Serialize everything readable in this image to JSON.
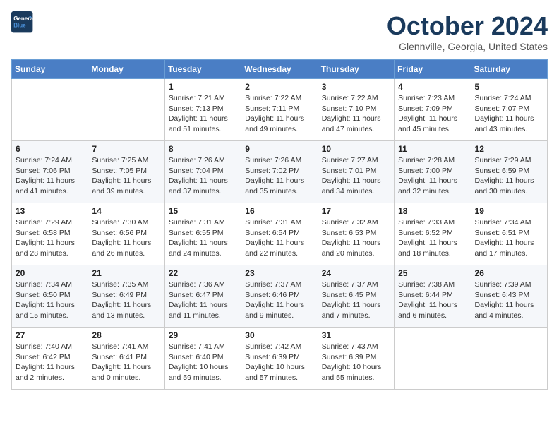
{
  "header": {
    "logo_line1": "General",
    "logo_line2": "Blue",
    "month_title": "October 2024",
    "location": "Glennville, Georgia, United States"
  },
  "weekdays": [
    "Sunday",
    "Monday",
    "Tuesday",
    "Wednesday",
    "Thursday",
    "Friday",
    "Saturday"
  ],
  "weeks": [
    [
      {
        "day": "",
        "info": ""
      },
      {
        "day": "",
        "info": ""
      },
      {
        "day": "1",
        "info": "Sunrise: 7:21 AM\nSunset: 7:13 PM\nDaylight: 11 hours and 51 minutes."
      },
      {
        "day": "2",
        "info": "Sunrise: 7:22 AM\nSunset: 7:11 PM\nDaylight: 11 hours and 49 minutes."
      },
      {
        "day": "3",
        "info": "Sunrise: 7:22 AM\nSunset: 7:10 PM\nDaylight: 11 hours and 47 minutes."
      },
      {
        "day": "4",
        "info": "Sunrise: 7:23 AM\nSunset: 7:09 PM\nDaylight: 11 hours and 45 minutes."
      },
      {
        "day": "5",
        "info": "Sunrise: 7:24 AM\nSunset: 7:07 PM\nDaylight: 11 hours and 43 minutes."
      }
    ],
    [
      {
        "day": "6",
        "info": "Sunrise: 7:24 AM\nSunset: 7:06 PM\nDaylight: 11 hours and 41 minutes."
      },
      {
        "day": "7",
        "info": "Sunrise: 7:25 AM\nSunset: 7:05 PM\nDaylight: 11 hours and 39 minutes."
      },
      {
        "day": "8",
        "info": "Sunrise: 7:26 AM\nSunset: 7:04 PM\nDaylight: 11 hours and 37 minutes."
      },
      {
        "day": "9",
        "info": "Sunrise: 7:26 AM\nSunset: 7:02 PM\nDaylight: 11 hours and 35 minutes."
      },
      {
        "day": "10",
        "info": "Sunrise: 7:27 AM\nSunset: 7:01 PM\nDaylight: 11 hours and 34 minutes."
      },
      {
        "day": "11",
        "info": "Sunrise: 7:28 AM\nSunset: 7:00 PM\nDaylight: 11 hours and 32 minutes."
      },
      {
        "day": "12",
        "info": "Sunrise: 7:29 AM\nSunset: 6:59 PM\nDaylight: 11 hours and 30 minutes."
      }
    ],
    [
      {
        "day": "13",
        "info": "Sunrise: 7:29 AM\nSunset: 6:58 PM\nDaylight: 11 hours and 28 minutes."
      },
      {
        "day": "14",
        "info": "Sunrise: 7:30 AM\nSunset: 6:56 PM\nDaylight: 11 hours and 26 minutes."
      },
      {
        "day": "15",
        "info": "Sunrise: 7:31 AM\nSunset: 6:55 PM\nDaylight: 11 hours and 24 minutes."
      },
      {
        "day": "16",
        "info": "Sunrise: 7:31 AM\nSunset: 6:54 PM\nDaylight: 11 hours and 22 minutes."
      },
      {
        "day": "17",
        "info": "Sunrise: 7:32 AM\nSunset: 6:53 PM\nDaylight: 11 hours and 20 minutes."
      },
      {
        "day": "18",
        "info": "Sunrise: 7:33 AM\nSunset: 6:52 PM\nDaylight: 11 hours and 18 minutes."
      },
      {
        "day": "19",
        "info": "Sunrise: 7:34 AM\nSunset: 6:51 PM\nDaylight: 11 hours and 17 minutes."
      }
    ],
    [
      {
        "day": "20",
        "info": "Sunrise: 7:34 AM\nSunset: 6:50 PM\nDaylight: 11 hours and 15 minutes."
      },
      {
        "day": "21",
        "info": "Sunrise: 7:35 AM\nSunset: 6:49 PM\nDaylight: 11 hours and 13 minutes."
      },
      {
        "day": "22",
        "info": "Sunrise: 7:36 AM\nSunset: 6:47 PM\nDaylight: 11 hours and 11 minutes."
      },
      {
        "day": "23",
        "info": "Sunrise: 7:37 AM\nSunset: 6:46 PM\nDaylight: 11 hours and 9 minutes."
      },
      {
        "day": "24",
        "info": "Sunrise: 7:37 AM\nSunset: 6:45 PM\nDaylight: 11 hours and 7 minutes."
      },
      {
        "day": "25",
        "info": "Sunrise: 7:38 AM\nSunset: 6:44 PM\nDaylight: 11 hours and 6 minutes."
      },
      {
        "day": "26",
        "info": "Sunrise: 7:39 AM\nSunset: 6:43 PM\nDaylight: 11 hours and 4 minutes."
      }
    ],
    [
      {
        "day": "27",
        "info": "Sunrise: 7:40 AM\nSunset: 6:42 PM\nDaylight: 11 hours and 2 minutes."
      },
      {
        "day": "28",
        "info": "Sunrise: 7:41 AM\nSunset: 6:41 PM\nDaylight: 11 hours and 0 minutes."
      },
      {
        "day": "29",
        "info": "Sunrise: 7:41 AM\nSunset: 6:40 PM\nDaylight: 10 hours and 59 minutes."
      },
      {
        "day": "30",
        "info": "Sunrise: 7:42 AM\nSunset: 6:39 PM\nDaylight: 10 hours and 57 minutes."
      },
      {
        "day": "31",
        "info": "Sunrise: 7:43 AM\nSunset: 6:39 PM\nDaylight: 10 hours and 55 minutes."
      },
      {
        "day": "",
        "info": ""
      },
      {
        "day": "",
        "info": ""
      }
    ]
  ]
}
